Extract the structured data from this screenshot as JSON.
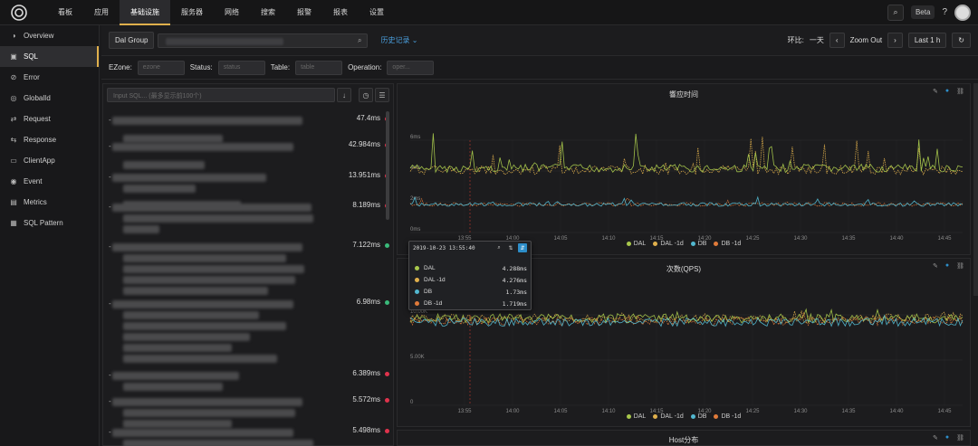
{
  "nav": {
    "items": [
      "看板",
      "应用",
      "基础设施",
      "服务器",
      "网络",
      "搜索",
      "报警",
      "报表",
      "设置"
    ],
    "active": 2,
    "beta": "Beta",
    "help": "?"
  },
  "sidebar": {
    "items": [
      {
        "label": "Overview",
        "icon": "overview-icon"
      },
      {
        "label": "SQL",
        "icon": "database-icon"
      },
      {
        "label": "Error",
        "icon": "error-icon"
      },
      {
        "label": "GlobalId",
        "icon": "globe-icon"
      },
      {
        "label": "Request",
        "icon": "request-icon"
      },
      {
        "label": "Response",
        "icon": "response-icon"
      },
      {
        "label": "ClientApp",
        "icon": "client-icon"
      },
      {
        "label": "Event",
        "icon": "event-icon"
      },
      {
        "label": "Metrics",
        "icon": "metrics-icon"
      },
      {
        "label": "SQL Pattern",
        "icon": "pattern-icon"
      }
    ],
    "active": 1
  },
  "toolbar": {
    "group_label": "Dal Group",
    "history": "历史记录 ⌄",
    "compare_label": "环比:",
    "compare_value": "一天",
    "zoom_out": "Zoom Out",
    "range": "Last 1 h"
  },
  "filters": {
    "ezone_label": "EZone:",
    "ezone_ph": "ezone",
    "status_label": "Status:",
    "status_ph": "status",
    "table_label": "Table:",
    "table_ph": "table",
    "operation_label": "Operation:",
    "operation_ph": "oper..."
  },
  "sql": {
    "search_ph": "Input SQL... (最多显示前100个)",
    "items": [
      {
        "time": "47.4ms",
        "status": "red"
      },
      {
        "time": "42.984ms",
        "status": "red"
      },
      {
        "time": "13.951ms",
        "status": "red"
      },
      {
        "time": "8.189ms",
        "status": "red"
      },
      {
        "time": "7.122ms",
        "status": "green"
      },
      {
        "time": "6.98ms",
        "status": "green"
      },
      {
        "time": "6.389ms",
        "status": "red"
      },
      {
        "time": "5.572ms",
        "status": "red"
      },
      {
        "time": "5.498ms",
        "status": "red"
      }
    ]
  },
  "charts": {
    "latency": {
      "title": "響应时间",
      "ylabels": [
        "6ms",
        "4ms",
        "2ms",
        "0ms"
      ],
      "xlabels": [
        "13:55",
        "14:00",
        "14:05",
        "14:10",
        "14:15",
        "14:20",
        "14:25",
        "14:30",
        "14:35",
        "14:40",
        "14:45"
      ]
    },
    "qps": {
      "title": "次数(QPS)",
      "ylabels": [
        "10.00K",
        "5.00K",
        "0"
      ],
      "xlabels": [
        "13:55",
        "14:00",
        "14:05",
        "14:10",
        "14:15",
        "14:20",
        "14:25",
        "14:30",
        "14:35",
        "14:40",
        "14:45"
      ]
    },
    "host": {
      "title": "Host分布"
    },
    "legend": [
      "DAL",
      "DAL -1d",
      "DB",
      "DB -1d"
    ],
    "colors": {
      "dal": "#a8c84c",
      "dal1d": "#e0b04c",
      "db": "#52b8d0",
      "db1d": "#e07a3a"
    }
  },
  "tooltip": {
    "time": "2019-10-23 13:55:40",
    "rows": [
      {
        "name": "DAL",
        "value": "4.288ms",
        "color": "#a8c84c"
      },
      {
        "name": "DAL -1d",
        "value": "4.276ms",
        "color": "#e0b04c"
      },
      {
        "name": "DB",
        "value": "1.73ms",
        "color": "#52b8d0"
      },
      {
        "name": "DB -1d",
        "value": "1.719ms",
        "color": "#e07a3a"
      }
    ]
  }
}
